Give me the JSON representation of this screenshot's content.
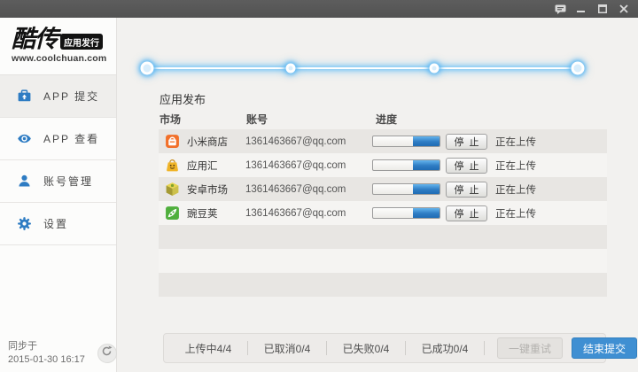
{
  "window": {
    "titlebar_controls": [
      {
        "id": "feedback",
        "icon": "speech-bubble-icon"
      },
      {
        "id": "minimize",
        "icon": "minimize-icon"
      },
      {
        "id": "maximize",
        "icon": "maximize-icon"
      },
      {
        "id": "close",
        "icon": "close-icon"
      }
    ]
  },
  "sidebar": {
    "logo": {
      "brand": "酷传",
      "badge": "应用发行",
      "url": "www.coolchuan.com"
    },
    "items": [
      {
        "id": "app-submit",
        "label": "APP 提交",
        "icon": "briefcase-upload-icon",
        "selected": true
      },
      {
        "id": "app-view",
        "label": "APP 查看",
        "icon": "eye-icon",
        "selected": false
      },
      {
        "id": "account-manage",
        "label": "账号管理",
        "icon": "user-icon",
        "selected": false
      },
      {
        "id": "settings",
        "label": "设置",
        "icon": "gear-icon",
        "selected": false
      }
    ],
    "sync": {
      "label": "同步于",
      "timestamp": "2015-01-30 16:17",
      "icon": "refresh-icon"
    }
  },
  "main": {
    "stepper": {
      "steps": 4
    },
    "section_title": "应用发布",
    "table": {
      "headers": {
        "market": "市场",
        "account": "账号",
        "progress": "进度"
      },
      "rows": [
        {
          "market": "小米商店",
          "icon": "xiaomi-store",
          "account": "1361463667@qq.com",
          "progress_fill_percent": 40,
          "action_label": "停止",
          "status": "正在上传"
        },
        {
          "market": "应用汇",
          "icon": "appchina",
          "account": "1361463667@qq.com",
          "progress_fill_percent": 40,
          "action_label": "停止",
          "status": "正在上传"
        },
        {
          "market": "安卓市场",
          "icon": "android-market",
          "account": "1361463667@qq.com",
          "progress_fill_percent": 40,
          "action_label": "停止",
          "status": "正在上传"
        },
        {
          "market": "豌豆荚",
          "icon": "wandoujia",
          "account": "1361463667@qq.com",
          "progress_fill_percent": 40,
          "action_label": "停止",
          "status": "正在上传"
        }
      ],
      "empty_rows": 3
    },
    "footer": {
      "stats": [
        "上传中4/4",
        "已取消0/4",
        "已失败0/4",
        "已成功0/4"
      ],
      "retry_button": {
        "label": "一键重试",
        "enabled": false
      },
      "submit_button": {
        "label": "结束提交",
        "enabled": true
      }
    }
  },
  "colors": {
    "accent_blue": "#2e7cc3",
    "submit_button_blue": "#3f8fd2",
    "titlebar_gray": "#565656",
    "stepper_glow": "#6cc1f5",
    "xiaomi_orange": "#f2702a",
    "appchina_yellow": "#f0b428",
    "android_khaki": "#cdc14b",
    "wandoujia_green": "#4faf3c"
  }
}
